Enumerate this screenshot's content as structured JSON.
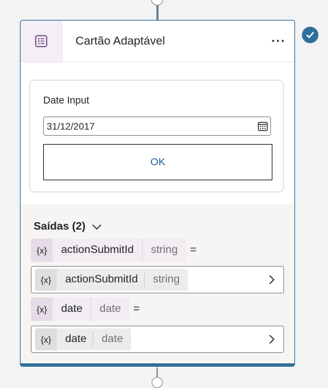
{
  "node": {
    "title": "Cartão Adaptável",
    "more_label": "···"
  },
  "card": {
    "field_label": "Date Input",
    "date_value": "31/12/2017",
    "ok_label": "OK"
  },
  "outputs": {
    "title": "Saídas (2)",
    "variables": [
      {
        "icon_text": "{x}",
        "name": "actionSubmitId",
        "type": "string",
        "equals": "=",
        "value": {
          "icon_text": "{x}",
          "name": "actionSubmitId",
          "type": "string"
        }
      },
      {
        "icon_text": "{x}",
        "name": "date",
        "type": "date",
        "equals": "=",
        "value": {
          "icon_text": "{x}",
          "name": "date",
          "type": "date"
        }
      }
    ]
  },
  "colors": {
    "accent": "#2e6f99",
    "ok_text": "#1f5b91",
    "chip": "#f1edf2"
  },
  "icons": [
    "adaptive-card-icon",
    "more-icon",
    "check-icon",
    "calendar-icon",
    "chevron-down-icon",
    "variable-icon",
    "chevron-right-icon"
  ]
}
